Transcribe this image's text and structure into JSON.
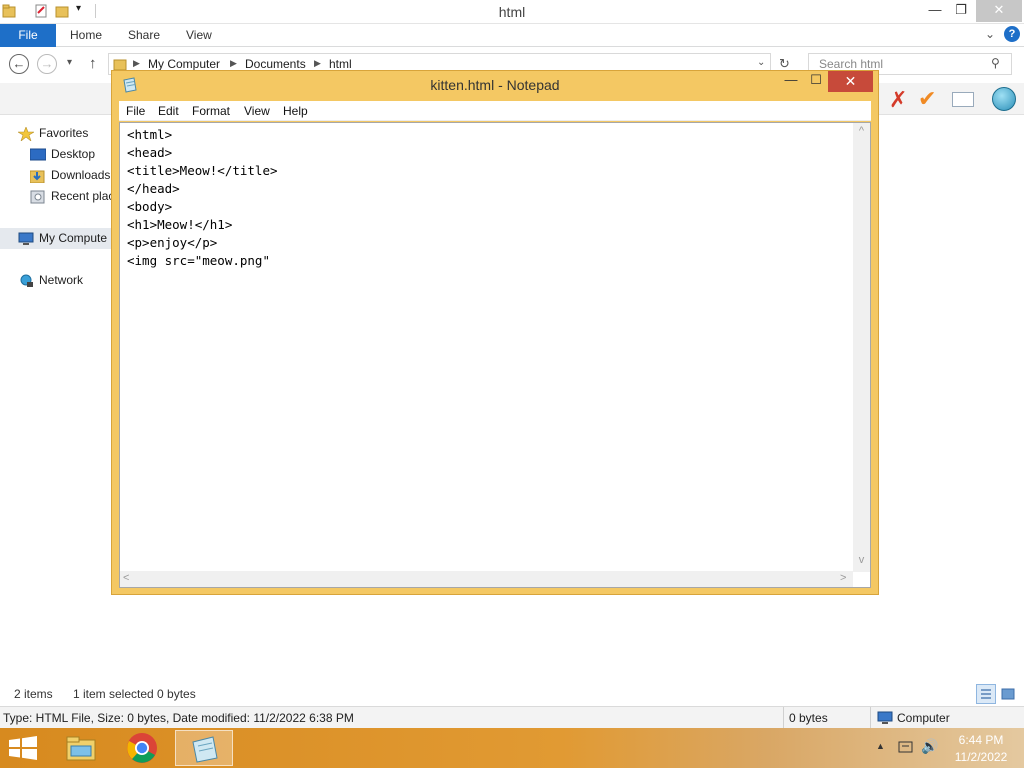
{
  "explorer": {
    "title": "html",
    "ribbon_tabs": [
      "File",
      "Home",
      "Share",
      "View"
    ],
    "breadcrumb": [
      "My Computer",
      "Documents",
      "html"
    ],
    "search_placeholder": "Search html",
    "nav": {
      "favorites": "Favorites",
      "desktop": "Desktop",
      "downloads": "Downloads",
      "recent": "Recent plac",
      "computer": "My Compute",
      "network": "Network"
    },
    "status": {
      "items": "2 items",
      "selected": "1 item selected  0 bytes"
    },
    "details": {
      "info": "Type: HTML File, Size: 0 bytes, Date modified: 11/2/2022 6:38 PM",
      "size": "0 bytes",
      "location": "Computer"
    }
  },
  "notepad": {
    "title": "kitten.html - Notepad",
    "menu": [
      "File",
      "Edit",
      "Format",
      "View",
      "Help"
    ],
    "content": "<html>\n<head>\n<title>Meow!</title>\n</head>\n<body>\n<h1>Meow!</h1>\n<p>enjoy</p>\n<img src=\"meow.png\""
  },
  "taskbar": {
    "time": "6:44 PM",
    "date": "11/2/2022"
  },
  "colors": {
    "accent_blue": "#1e6fc8",
    "notepad_frame": "#f4c863",
    "taskbar": "#e19a33",
    "close_red": "#c74a3a"
  }
}
